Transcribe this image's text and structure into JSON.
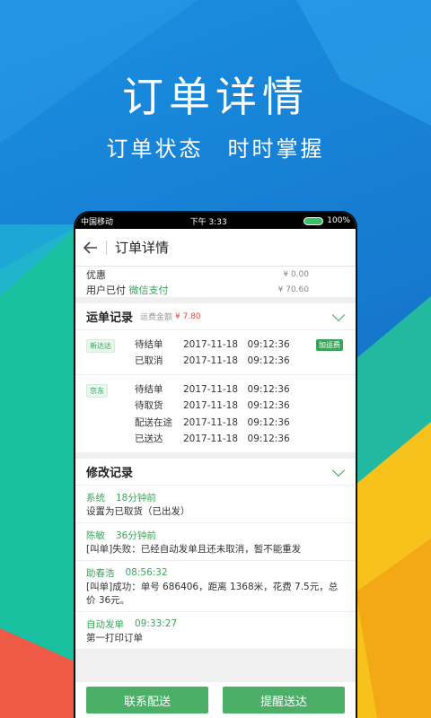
{
  "hero": {
    "title": "订单详情",
    "subtitle": "订单状态　时时掌握"
  },
  "colors": {
    "accent": "#3aa55a",
    "button": "#4caf68",
    "fee": "#e2463c",
    "background": "#1a86d8"
  },
  "statusbar": {
    "carrier": "中国移动",
    "time": "下午 3:33",
    "battery": "100%"
  },
  "navbar": {
    "back_icon": "arrow-left-icon",
    "title": "订单详情"
  },
  "payment": {
    "discount_label": "优惠",
    "discount_value": "¥ 0.00",
    "paid_label": "用户已付",
    "paid_method": "微信支付",
    "paid_value": "¥ 70.60"
  },
  "waybill": {
    "title": "运单记录",
    "fee_label": "运费金额",
    "fee_value": "¥ 7.80",
    "groups": [
      {
        "tag": "新达达",
        "badge": "加运费",
        "rows": [
          {
            "status": "待结单",
            "time": "2017-11-18　09:12:36"
          },
          {
            "status": "已取消",
            "time": "2017-11-18　09:12:36"
          }
        ]
      },
      {
        "tag": "京东",
        "rows": [
          {
            "status": "待结单",
            "time": "2017-11-18　09:12:36"
          },
          {
            "status": "待取货",
            "time": "2017-11-18　09:12:36"
          },
          {
            "status": "配送在途",
            "time": "2017-11-18　09:12:36"
          },
          {
            "status": "已送达",
            "time": "2017-11-18　09:12:36"
          }
        ]
      }
    ]
  },
  "changes": {
    "title": "修改记录",
    "logs": [
      {
        "who": "系统",
        "when": "18分钟前",
        "text": "设置为已取货（已出发）"
      },
      {
        "who": "陈敏",
        "when": "36分钟前",
        "text": "[叫单]失败：已经自动发单且还未取消，暂不能重发"
      },
      {
        "who": "助春浩",
        "when": "08:56:32",
        "text": "[叫单]成功：单号 686406，距离 1368米，花费 7.5元，总价 36元。"
      },
      {
        "who": "自动发单",
        "when": "09:33:27",
        "text": "第一打印订单"
      }
    ]
  },
  "footer": {
    "contact_label": "联系配送",
    "remind_label": "提醒送达"
  }
}
